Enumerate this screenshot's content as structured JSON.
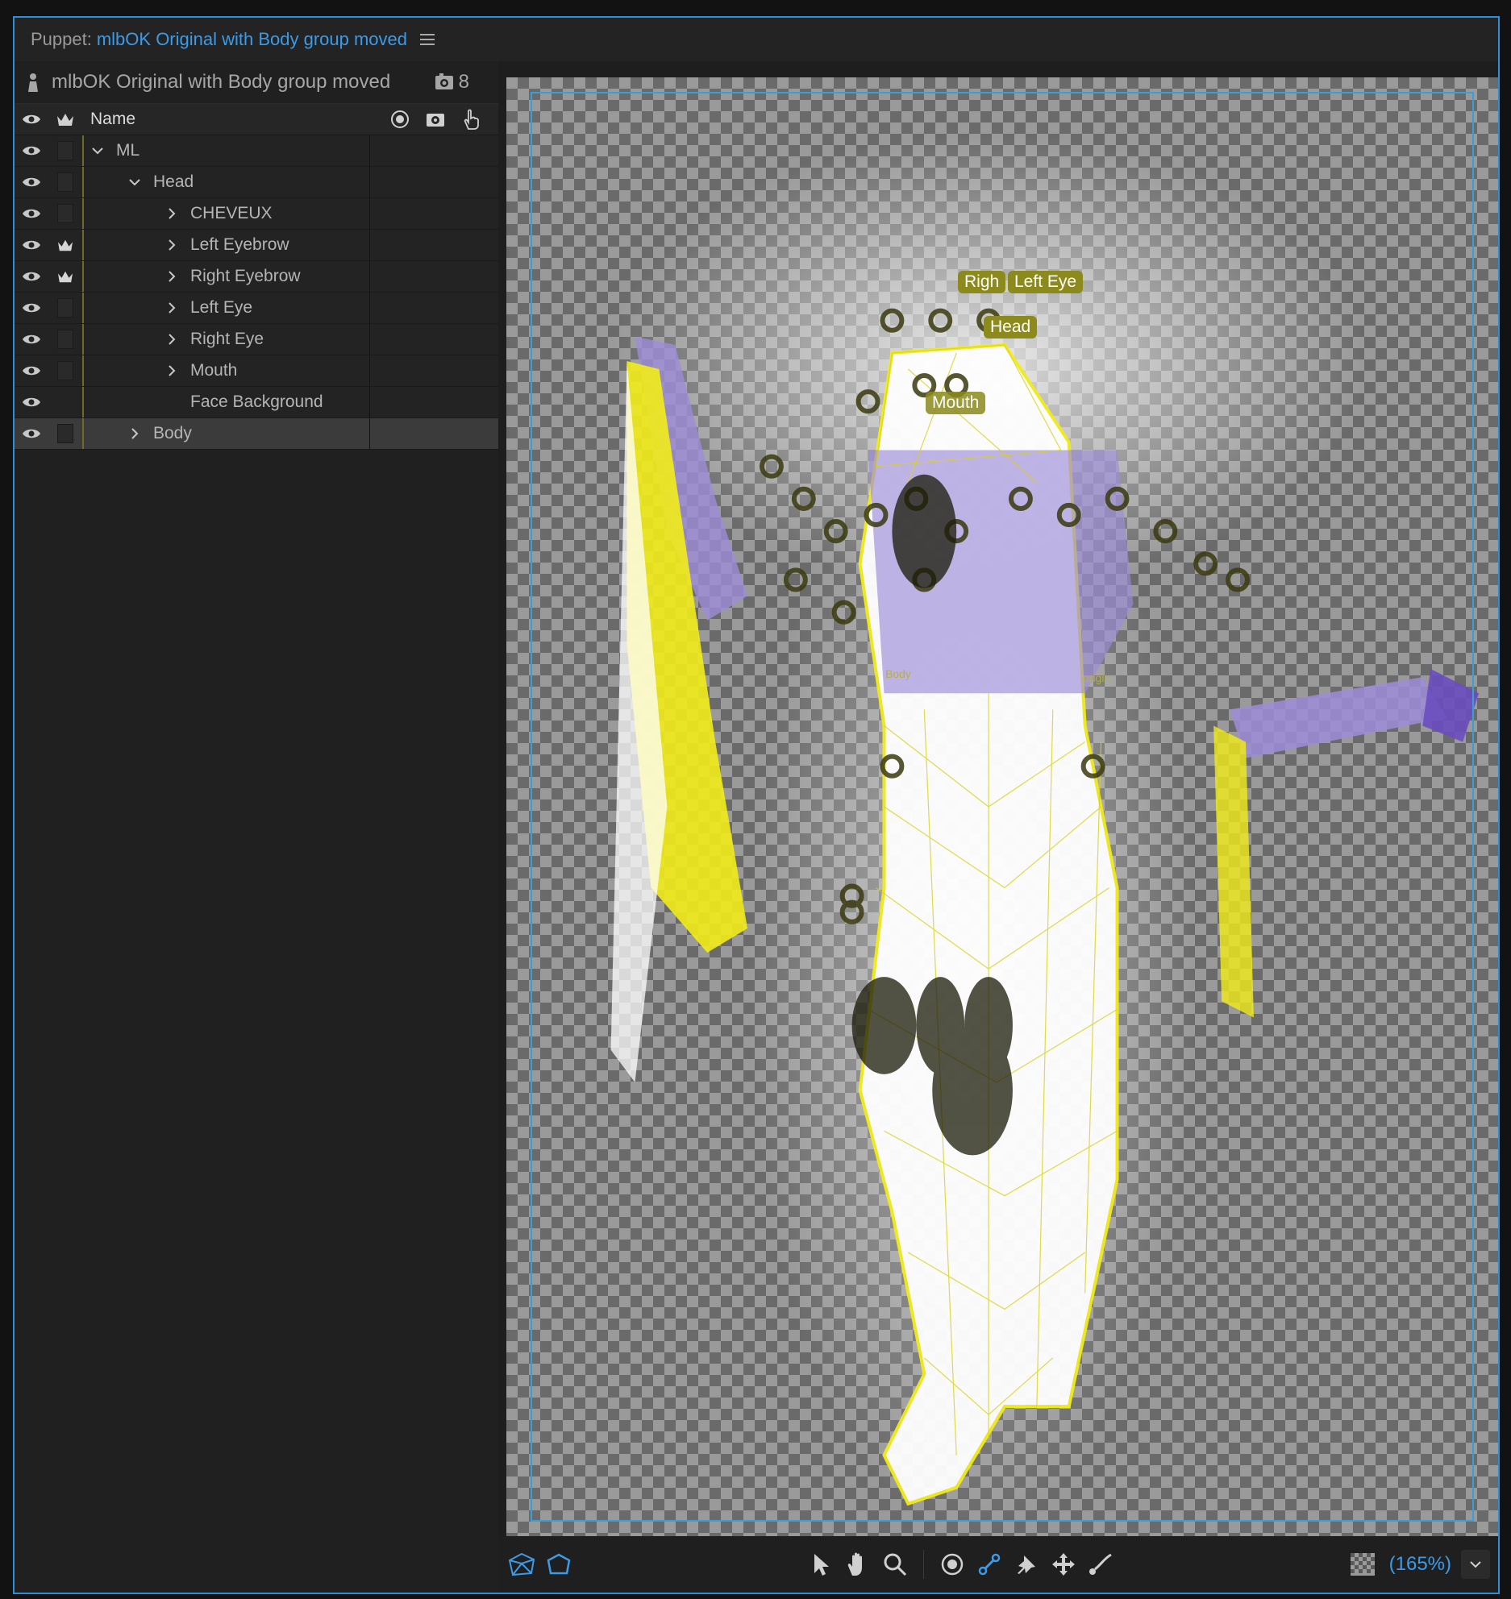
{
  "panel": {
    "label": "Puppet:",
    "puppet_name": "mlbOK Original with Body group moved"
  },
  "puppet_row": {
    "name": "mlbOK Original with Body group moved",
    "camera_count": "8"
  },
  "columns": {
    "name": "Name"
  },
  "layers": [
    {
      "label": "ML",
      "indent": 0,
      "chevron": "down",
      "crown": false,
      "swatch": true
    },
    {
      "label": "Head",
      "indent": 1,
      "chevron": "down",
      "crown": false,
      "swatch": true
    },
    {
      "label": "CHEVEUX",
      "indent": 2,
      "chevron": "right",
      "crown": false,
      "swatch": true
    },
    {
      "label": "Left Eyebrow",
      "indent": 2,
      "chevron": "right",
      "crown": true,
      "swatch": false
    },
    {
      "label": "Right Eyebrow",
      "indent": 2,
      "chevron": "right",
      "crown": true,
      "swatch": false
    },
    {
      "label": "Left Eye",
      "indent": 2,
      "chevron": "right",
      "crown": false,
      "swatch": true
    },
    {
      "label": "Right Eye",
      "indent": 2,
      "chevron": "right",
      "crown": false,
      "swatch": true
    },
    {
      "label": "Mouth",
      "indent": 2,
      "chevron": "right",
      "crown": false,
      "swatch": true
    },
    {
      "label": "Face Background",
      "indent": 2,
      "chevron": "none",
      "crown": false,
      "swatch": false
    },
    {
      "label": "Body",
      "indent": 1,
      "chevron": "right",
      "crown": false,
      "swatch": true,
      "selected": true
    }
  ],
  "canvas_labels": {
    "right_eye": "Righ",
    "left_eye": "Left Eye",
    "head": "Head",
    "mouth": "Mouth",
    "body": "Body",
    "origin": "origin"
  },
  "zoom": "(165%)",
  "colors": {
    "accent": "#3c9be8",
    "mesh": "#f2ec1a",
    "pin_label_bg": "#8c8a1d"
  }
}
